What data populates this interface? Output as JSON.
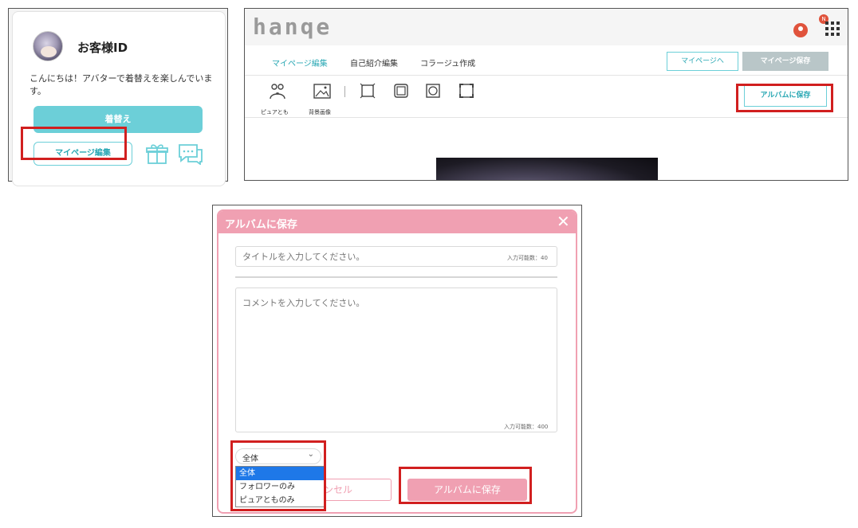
{
  "profile_card": {
    "customer_id": "お客様ID",
    "greeting": "こんにちは！アバターで着替えを楽しんでいます。",
    "change_button": "着替え",
    "mypage_edit_button": "マイページ編集"
  },
  "editor": {
    "logo": "hanqe",
    "notification_badge": "N",
    "tabs": [
      "マイページ編集",
      "自己紹介編集",
      "コラージュ作成"
    ],
    "to_mypage_button": "マイページへ",
    "save_mypage_button": "マイページ保存",
    "tools": [
      "ピュアとも",
      "背景画像"
    ],
    "save_to_album_button": "アルバムに保存"
  },
  "album_dialog": {
    "title": "アルバムに保存",
    "title_placeholder": "タイトルを入力してください。",
    "title_count": "入力可能数：40",
    "comment_placeholder": "コメントを入力してください。",
    "comment_count": "入力可能数：400",
    "visibility_selected": "全体",
    "visibility_options": [
      "全体",
      "フォロワーのみ",
      "ピュアとものみ"
    ],
    "cancel_button_visible": "ンセル",
    "save_button": "アルバムに保存"
  },
  "colors": {
    "teal_accent": "#6ccfd8",
    "pink_accent": "#f0a0b2",
    "highlight_red": "#d11f1f",
    "dropdown_selected": "#1e78e8"
  }
}
